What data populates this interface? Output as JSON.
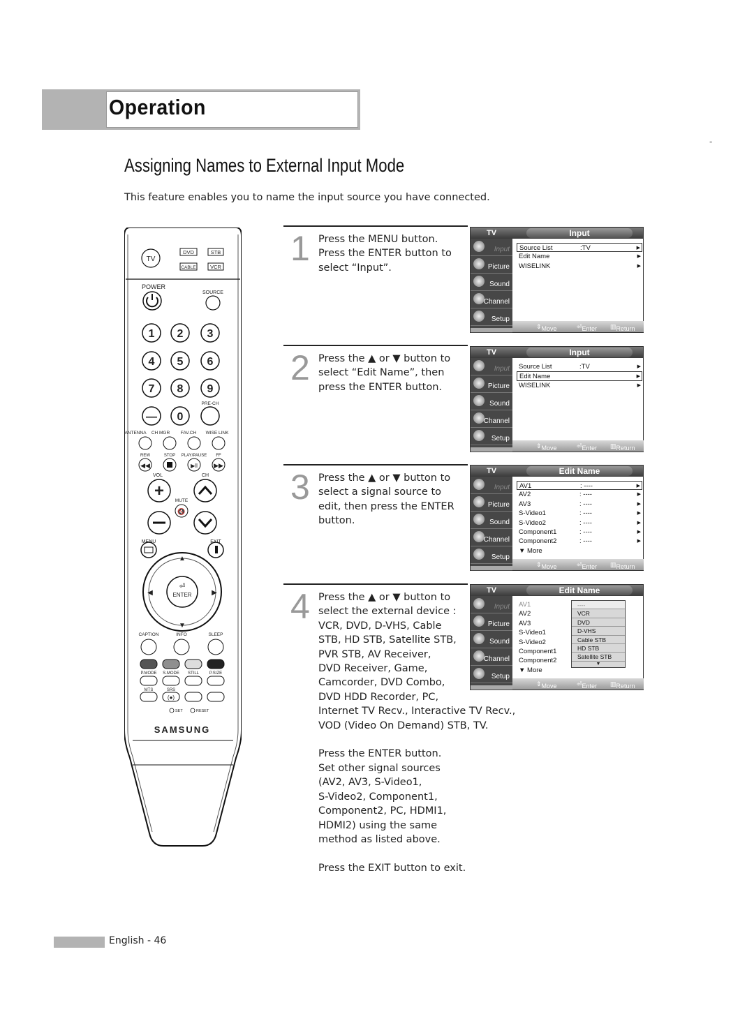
{
  "header": {
    "section": "Operation"
  },
  "page_mark": "-",
  "title": "Assigning Names to External Input Mode",
  "intro": "This feature enables you to name the input source you have connected.",
  "remote": {
    "source_buttons": [
      "DVD",
      "STB",
      "CABLE",
      "VCR"
    ],
    "tv": "TV",
    "power": "POWER",
    "source": "SOURCE",
    "digits": [
      "1",
      "2",
      "3",
      "4",
      "5",
      "6",
      "7",
      "8",
      "9",
      "—",
      "0"
    ],
    "pre_ch": "PRE-CH",
    "row_labels": [
      "ANTENNA",
      "CH MGR",
      "FAV.CH",
      "WISE LINK"
    ],
    "transport_labels": [
      "REW",
      "STOP",
      "PLAY/PAUSE",
      "FF"
    ],
    "vol": "VOL",
    "ch": "CH",
    "mute": "MUTE",
    "menu": "MENU",
    "exit": "EXIT",
    "enter": "ENTER",
    "info_labels": [
      "CAPTION",
      "INFO",
      "SLEEP"
    ],
    "color_button_colors": [
      "#555555",
      "#8f8f8f",
      "#dddddd",
      "#222222"
    ],
    "mode_labels": [
      "P.MODE",
      "S.MODE",
      "STILL",
      "P.SIZE"
    ],
    "bottom_labels": [
      "MTS",
      "SRS"
    ],
    "set": "SET",
    "reset": "RESET",
    "brand": "SAMSUNG"
  },
  "steps": [
    {
      "num": "1",
      "lines": [
        "Press the MENU button.",
        "Press the ENTER button to",
        "select “Input”."
      ]
    },
    {
      "num": "2",
      "lines": [
        "Press the ▲ or ▼ button to",
        "select “Edit Name”, then",
        "press the ENTER button."
      ]
    },
    {
      "num": "3",
      "lines": [
        "Press the ▲ or ▼ button to",
        "select a signal source to",
        "edit, then press the ENTER",
        "button."
      ]
    },
    {
      "num": "4",
      "lines": [
        "Press the ▲ or ▼ button to",
        "select the external device :",
        "VCR, DVD, D-VHS, Cable",
        "STB, HD STB, Satellite STB,",
        "PVR STB, AV Receiver,",
        "DVD Receiver, Game,",
        "Camcorder, DVD Combo,",
        "DVD HDD Recorder, PC,",
        "Internet TV Recv., Interactive TV Recv.,",
        "VOD (Video On Demand) STB, TV.",
        "",
        "Press the ENTER button.",
        "Set other signal sources",
        "(AV2, AV3, S-Video1,",
        "S-Video2, Component1,",
        "Component2, PC, HDMI1,",
        "HDMI2) using the same",
        "method as listed above.",
        "",
        "Press the EXIT button to exit."
      ]
    }
  ],
  "osd": {
    "tv_label": "TV",
    "sidebar": [
      "Input",
      "Picture",
      "Sound",
      "Channel",
      "Setup"
    ],
    "footer": {
      "move": "Move",
      "enter": "Enter",
      "return": "Return"
    },
    "screens": [
      {
        "title": "Input",
        "rows": [
          {
            "k": "Source List",
            "v": ":TV",
            "sel": true
          },
          {
            "k": "Edit Name",
            "v": ""
          },
          {
            "k": "WISELINK",
            "v": ""
          }
        ]
      },
      {
        "title": "Input",
        "rows": [
          {
            "k": "Source List",
            "v": ":TV"
          },
          {
            "k": "Edit Name",
            "v": "",
            "sel": true
          },
          {
            "k": "WISELINK",
            "v": ""
          }
        ]
      },
      {
        "title": "Edit Name",
        "rows": [
          {
            "k": "AV1",
            "v": ": ----",
            "sel": true
          },
          {
            "k": "AV2",
            "v": ": ----"
          },
          {
            "k": "AV3",
            "v": ": ----"
          },
          {
            "k": "S-Video1",
            "v": ": ----"
          },
          {
            "k": "S-Video2",
            "v": ": ----"
          },
          {
            "k": "Component1",
            "v": ": ----"
          },
          {
            "k": "Component2",
            "v": ": ----"
          }
        ],
        "more": "▼ More"
      },
      {
        "title": "Edit Name",
        "rows": [
          {
            "k": "AV1"
          },
          {
            "k": "AV2"
          },
          {
            "k": "AV3"
          },
          {
            "k": "S-Video1"
          },
          {
            "k": "S-Video2"
          },
          {
            "k": "Component1"
          },
          {
            "k": "Component2"
          }
        ],
        "more": "▼ More",
        "dropdown": [
          "----",
          "VCR",
          "DVD",
          "D-VHS",
          "Cable STB",
          "HD STB",
          "Satellite STB"
        ]
      }
    ]
  },
  "footer": {
    "page": "English - 46"
  }
}
